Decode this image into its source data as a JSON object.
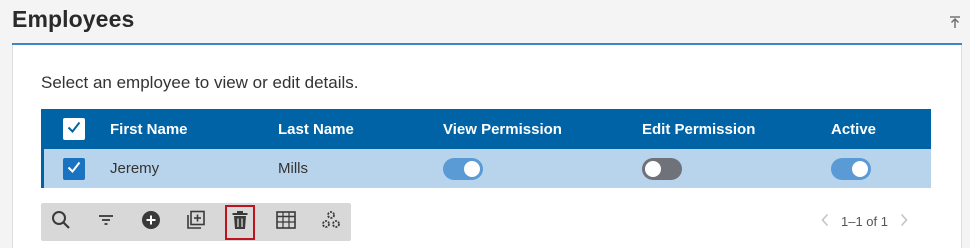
{
  "panel": {
    "title": "Employees",
    "instructions": "Select an employee to view or edit details."
  },
  "grid": {
    "columns": [
      "First Name",
      "Last Name",
      "View Permission",
      "Edit Permission",
      "Active"
    ],
    "rows": [
      {
        "selected": true,
        "first_name": "Jeremy",
        "last_name": "Mills",
        "view_permission": true,
        "edit_permission": false,
        "active": true
      }
    ]
  },
  "toolbar": {
    "icons": [
      "search-icon",
      "filter-icon",
      "add-icon",
      "duplicate-icon",
      "delete-icon",
      "columns-icon",
      "settings-icon"
    ],
    "highlighted": "delete-icon"
  },
  "pager": {
    "text": "1–1 of 1"
  },
  "colors": {
    "accent": "#0063a6",
    "selected_row": "#b8d4ec",
    "toggle_on": "#5a9bd5",
    "toggle_off": "#6f7278",
    "highlight": "#c1121f"
  }
}
